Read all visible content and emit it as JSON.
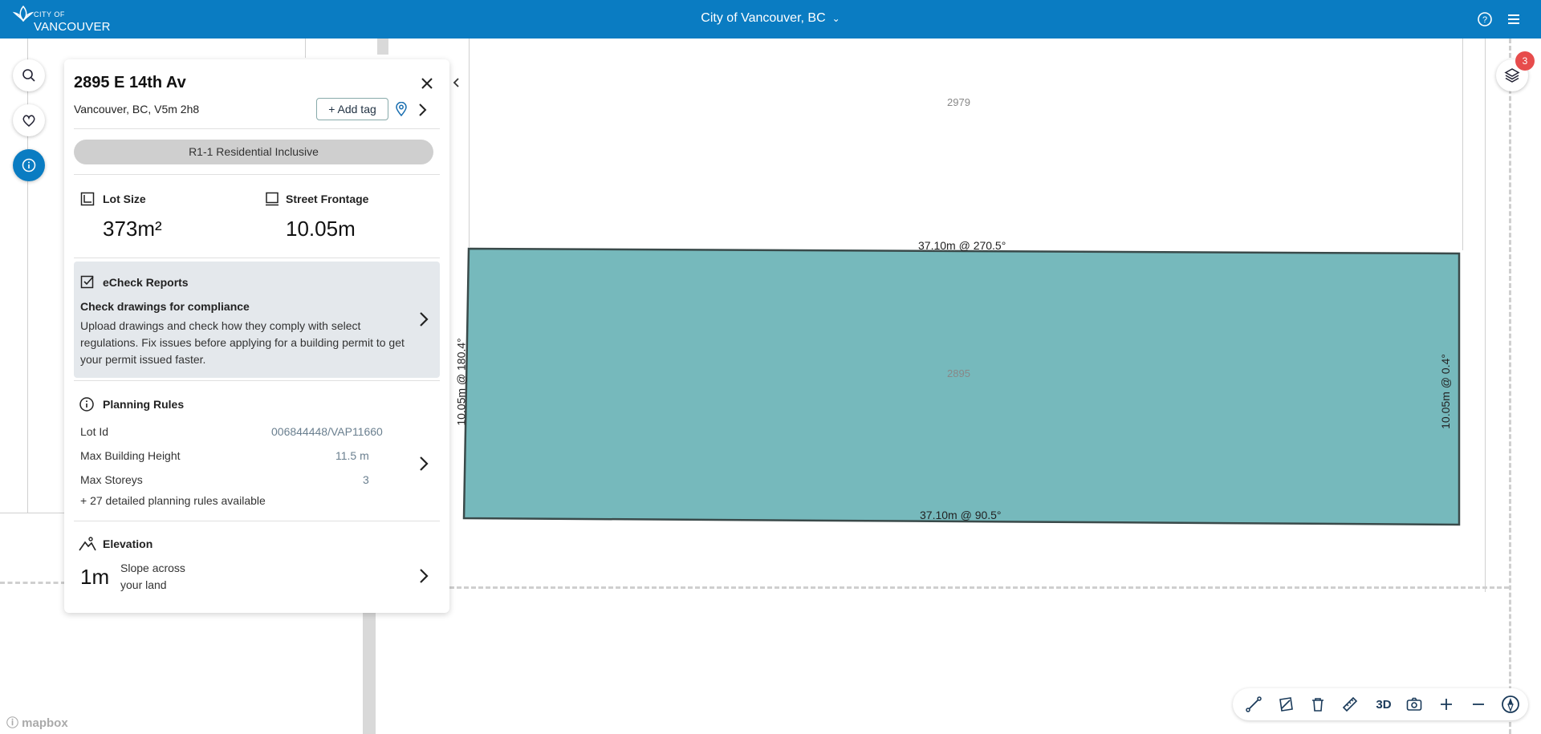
{
  "header": {
    "logo_small": "CITY OF",
    "logo_big": "VANCOUVER",
    "city_selector": "City of Vancouver, BC"
  },
  "map": {
    "lot_numbers": [
      "2979",
      "2895"
    ],
    "dimensions": {
      "top": "37.10m @ 270.5°",
      "bottom": "37.10m @ 90.5°",
      "left": "10.05m @ 180.4°",
      "right": "10.05m @ 0.4°"
    },
    "layers_badge": "3",
    "attribution": "mapbox",
    "parcel_color": "#76b9bc"
  },
  "panel": {
    "address": "2895 E 14th Av",
    "subaddress": "Vancouver, BC, V5m 2h8",
    "add_tag": "+ Add tag",
    "zoning": "R1-1 Residential Inclusive",
    "lot_size_label": "Lot Size",
    "lot_size_value": "373m²",
    "frontage_label": "Street Frontage",
    "frontage_value": "10.05m",
    "echeck": {
      "title": "eCheck Reports",
      "heading": "Check drawings for compliance",
      "body_line1": "Upload drawings and check how they comply with select",
      "body_line2": "regulations. Fix issues before applying for a building permit to get",
      "body_line3": "your permit issued faster."
    },
    "planning": {
      "title": "Planning Rules",
      "rows": [
        {
          "label": "Lot Id",
          "value": "006844448/VAP11660"
        },
        {
          "label": "Max Building Height",
          "value": "11.5 m"
        },
        {
          "label": "Max Storeys",
          "value": "3"
        }
      ],
      "more": "+ 27 detailed planning rules available"
    },
    "elevation": {
      "title": "Elevation",
      "value": "1m",
      "desc_line1": "Slope across",
      "desc_line2": "your land"
    }
  },
  "toolbar": {
    "three_d": "3D"
  },
  "colors": {
    "brand": "#0a7cc2",
    "badge": "#e74c4c"
  }
}
